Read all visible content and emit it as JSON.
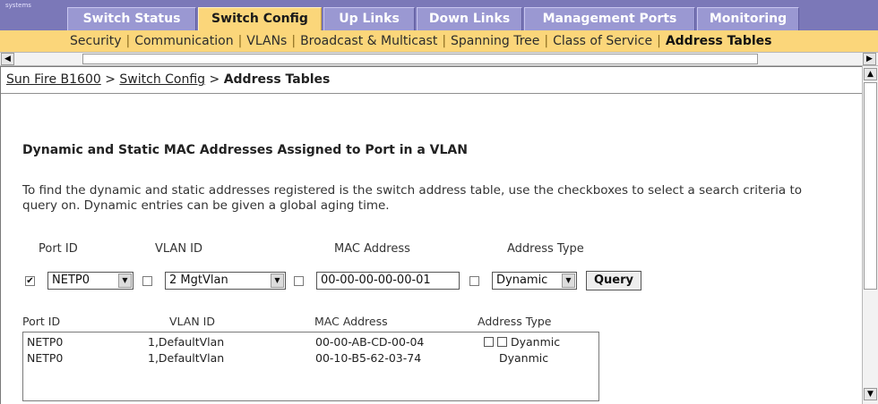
{
  "brand": "systems",
  "tabs": [
    {
      "label": "Switch Status",
      "active": false
    },
    {
      "label": "Switch Config",
      "active": true
    },
    {
      "label": "Up Links",
      "active": false
    },
    {
      "label": "Down Links",
      "active": false
    },
    {
      "label": "Management Ports",
      "active": false
    },
    {
      "label": "Monitoring",
      "active": false
    }
  ],
  "subnav": [
    {
      "label": "Security",
      "active": false
    },
    {
      "label": "Communication",
      "active": false
    },
    {
      "label": "VLANs",
      "active": false
    },
    {
      "label": "Broadcast & Multicast",
      "active": false
    },
    {
      "label": "Spanning Tree",
      "active": false
    },
    {
      "label": "Class of Service",
      "active": false
    },
    {
      "label": "Address Tables",
      "active": true
    }
  ],
  "subnav_separator": "|",
  "breadcrumb": {
    "root": "Sun Fire B1600",
    "sep": ">",
    "section": "Switch Config",
    "current": "Address Tables"
  },
  "heading": "Dynamic and Static MAC Addresses Assigned to Port in a VLAN",
  "description": "To find the dynamic and static addresses registered is the switch address table, use the checkboxes to select a search criteria to query on. Dynamic entries can be given a global aging time.",
  "query": {
    "labels": {
      "port_id": "Port ID",
      "vlan_id": "VLAN ID",
      "mac_address": "MAC Address",
      "address_type": "Address Type"
    },
    "port_checked": true,
    "port_value": "NETP0",
    "vlan_checked": false,
    "vlan_value": "2 MgtVlan",
    "mac_checked": false,
    "mac_value": "00-00-00-00-00-01",
    "type_checked": false,
    "type_value": "Dynamic",
    "button": "Query"
  },
  "results": {
    "headers": [
      "Port ID",
      "VLAN ID",
      "MAC Address",
      "Address Type"
    ],
    "rows": [
      {
        "port": "NETP0",
        "vlan": "1,DefaultVlan",
        "mac": "00-00-AB-CD-00-04",
        "type": "Dyanmic",
        "boxes": true
      },
      {
        "port": "NETP0",
        "vlan": "1,DefaultVlan",
        "mac": "00-10-B5-62-03-74",
        "type": "Dyanmic",
        "boxes": false
      }
    ]
  },
  "icons": {
    "check": "✔",
    "arrow_down": "▼",
    "arrow_up": "▲",
    "arrow_left": "◀",
    "arrow_right": "▶"
  },
  "colors": {
    "tab_bar": "#7b78b8",
    "tab": "#9a98d2",
    "tab_active": "#fbd67a",
    "subnav": "#fbd67a"
  }
}
